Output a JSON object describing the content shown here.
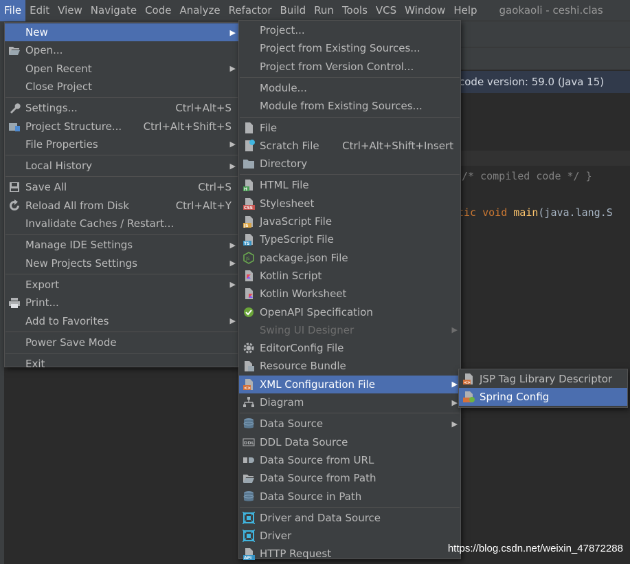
{
  "menubar": {
    "items": [
      "File",
      "Edit",
      "View",
      "Navigate",
      "Code",
      "Analyze",
      "Refactor",
      "Build",
      "Run",
      "Tools",
      "VCS",
      "Window",
      "Help"
    ],
    "active_index": 0,
    "window_title": "gaokaoli - ceshi.clas"
  },
  "editor": {
    "banner": "code version: 59.0 (Java 15)",
    "code_line1": "/* compiled code */ }",
    "code_line2_kw": "tic void",
    "code_line2_fn": "main",
    "code_line2_rest": "(java.lang.S"
  },
  "file_menu": {
    "items": [
      {
        "label": "New",
        "selected": true,
        "submenu": true,
        "icon": ""
      },
      {
        "label": "Open...",
        "icon": "folder-open-icon"
      },
      {
        "label": "Open Recent",
        "submenu": true
      },
      {
        "label": "Close Project"
      },
      {
        "label": "Settings...",
        "shortcut": "Ctrl+Alt+S",
        "icon": "wrench-icon"
      },
      {
        "label": "Project Structure...",
        "shortcut": "Ctrl+Alt+Shift+S",
        "icon": "project-structure-icon"
      },
      {
        "label": "File Properties",
        "submenu": true
      },
      {
        "label": "Local History",
        "submenu": true
      },
      {
        "label": "Save All",
        "shortcut": "Ctrl+S",
        "icon": "save-icon"
      },
      {
        "label": "Reload All from Disk",
        "shortcut": "Ctrl+Alt+Y",
        "icon": "reload-icon"
      },
      {
        "label": "Invalidate Caches / Restart..."
      },
      {
        "label": "Manage IDE Settings",
        "submenu": true
      },
      {
        "label": "New Projects Settings",
        "submenu": true
      },
      {
        "label": "Export",
        "submenu": true
      },
      {
        "label": "Print...",
        "icon": "printer-icon"
      },
      {
        "label": "Add to Favorites",
        "submenu": true
      },
      {
        "label": "Power Save Mode"
      },
      {
        "label": "Exit"
      }
    ]
  },
  "new_menu": {
    "items": [
      {
        "label": "Project..."
      },
      {
        "label": "Project from Existing Sources..."
      },
      {
        "label": "Project from Version Control..."
      },
      {
        "label": "Module..."
      },
      {
        "label": "Module from Existing Sources..."
      },
      {
        "label": "File",
        "icon": "file-icon"
      },
      {
        "label": "Scratch File",
        "shortcut": "Ctrl+Alt+Shift+Insert",
        "icon": "scratch-file-icon"
      },
      {
        "label": "Directory",
        "icon": "folder-icon"
      },
      {
        "label": "HTML File",
        "icon": "html-file-icon",
        "tag": "H"
      },
      {
        "label": "Stylesheet",
        "icon": "css-file-icon",
        "tag": "CSS"
      },
      {
        "label": "JavaScript File",
        "icon": "javascript-file-icon",
        "tag": "JS"
      },
      {
        "label": "TypeScript File",
        "icon": "typescript-file-icon",
        "tag": "TS"
      },
      {
        "label": "package.json File",
        "icon": "nodejs-icon"
      },
      {
        "label": "Kotlin Script",
        "icon": "kotlin-script-icon"
      },
      {
        "label": "Kotlin Worksheet",
        "icon": "kotlin-worksheet-icon"
      },
      {
        "label": "OpenAPI Specification",
        "icon": "openapi-icon"
      },
      {
        "label": "Swing UI Designer",
        "disabled": true,
        "submenu": true
      },
      {
        "label": "EditorConfig File",
        "icon": "gear-icon"
      },
      {
        "label": "Resource Bundle",
        "icon": "resource-bundle-icon"
      },
      {
        "label": "XML Configuration File",
        "selected": true,
        "submenu": true,
        "icon": "xml-file-icon"
      },
      {
        "label": "Diagram",
        "submenu": true,
        "icon": "diagram-icon"
      },
      {
        "label": "Data Source",
        "submenu": true,
        "icon": "database-icon"
      },
      {
        "label": "DDL Data Source",
        "icon": "ddl-icon",
        "tag": "DDL"
      },
      {
        "label": "Data Source from URL",
        "icon": "data-source-url-icon"
      },
      {
        "label": "Data Source from Path",
        "icon": "folder-open-icon"
      },
      {
        "label": "Data Source in Path",
        "icon": "database-icon"
      },
      {
        "label": "Driver and Data Source",
        "icon": "driver-icon"
      },
      {
        "label": "Driver",
        "icon": "driver-icon"
      },
      {
        "label": "HTTP Request",
        "icon": "api-icon",
        "tag": "API"
      }
    ]
  },
  "xml_menu": {
    "items": [
      {
        "label": "JSP Tag Library Descriptor",
        "icon": "xml-file-icon"
      },
      {
        "label": "Spring Config",
        "selected": true,
        "icon": "spring-xml-icon"
      }
    ]
  },
  "watermark": "https://blog.csdn.net/weixin_47872288",
  "colors": {
    "menu_bg": "#3c3f41",
    "selection": "#4b6eaf",
    "text": "#bbbbbb",
    "disabled": "#6d6d6d"
  }
}
